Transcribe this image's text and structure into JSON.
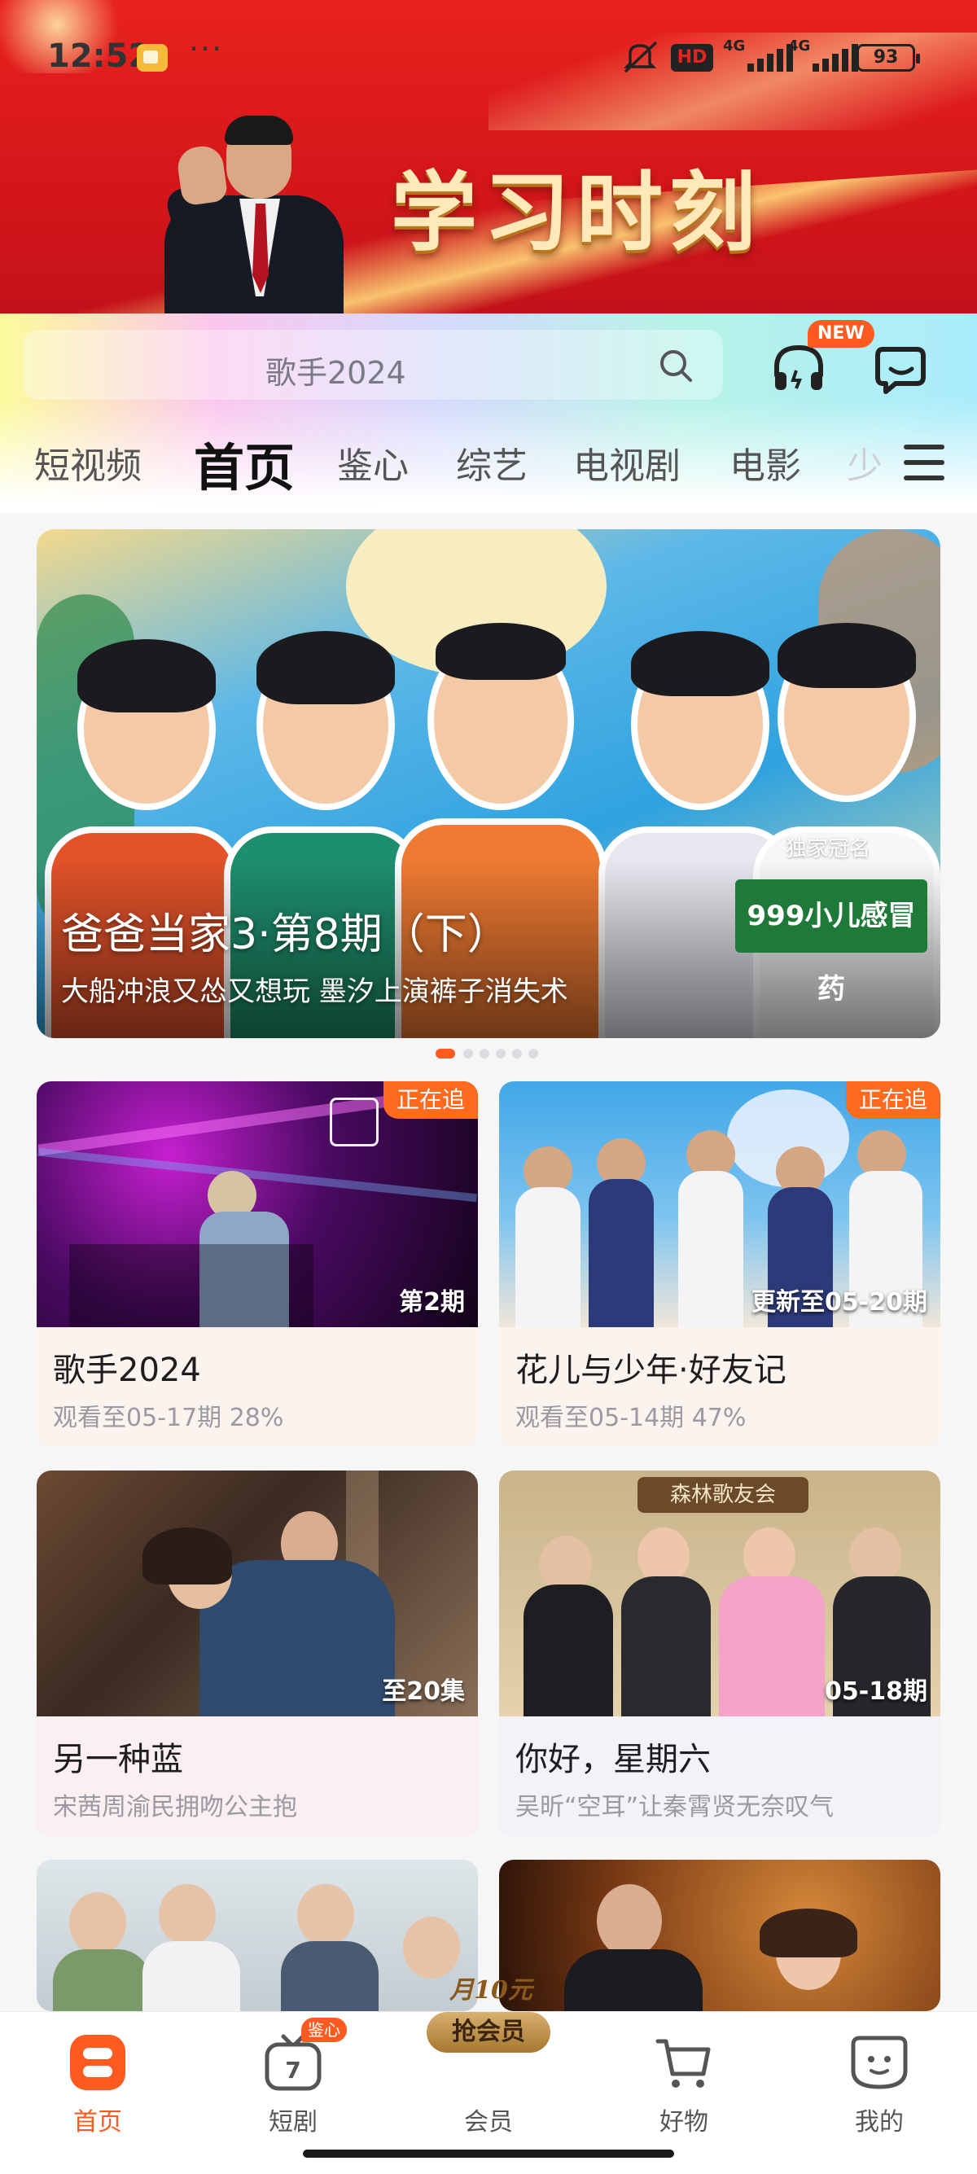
{
  "status_bar": {
    "time": "12:52",
    "more": "···",
    "hd": "HD",
    "sim1": "4G",
    "sim2": "4G",
    "battery": "93"
  },
  "banner": {
    "title": "学习时刻"
  },
  "header": {
    "search_placeholder": "歌手2024",
    "new_badge": "NEW"
  },
  "tabs": [
    {
      "label": "短视频"
    },
    {
      "label": "首页"
    },
    {
      "label": "鉴心"
    },
    {
      "label": "综艺"
    },
    {
      "label": "电视剧"
    },
    {
      "label": "电影"
    },
    {
      "label": "少"
    }
  ],
  "hero": {
    "title": "爸爸当家3·第8期（下）",
    "subtitle": "大船冲浪又怂又想玩 墨汐上演裤子消失术",
    "sponsor_tag": "独家冠名",
    "sponsor": "999小儿感冒药",
    "active_slide": 1,
    "slide_count": 6
  },
  "cards": [
    {
      "badge": "正在追",
      "overlay": "第2期",
      "name": "歌手2024",
      "info": "观看至05-17期 28%"
    },
    {
      "badge": "正在追",
      "overlay": "更新至05-20期",
      "name": "花儿与少年·好友记",
      "info": "观看至05-14期 47%"
    },
    {
      "badge": "",
      "overlay": "至20集",
      "name": "另一种蓝",
      "info": "宋茜周渝民拥吻公主抱"
    },
    {
      "badge": "",
      "overlay": "05-18期",
      "name": "你好，星期六",
      "info": "吴昕“空耳”让秦霄贤无奈叹气",
      "sign": "森林歌友会"
    },
    {
      "badge": "",
      "overlay": "",
      "name": "",
      "info": ""
    },
    {
      "badge": "",
      "overlay": "",
      "name": "",
      "info": ""
    }
  ],
  "bottom_nav": {
    "items": [
      {
        "label": "首页",
        "icon": "home-icon",
        "active": true
      },
      {
        "label": "短剧",
        "icon": "tv-icon",
        "badge": "鉴心"
      },
      {
        "label": "会员",
        "icon": "vip-icon"
      },
      {
        "label": "好物",
        "icon": "cart-icon"
      },
      {
        "label": "我的",
        "icon": "profile-icon"
      }
    ],
    "vip_promo_top": "月10元",
    "vip_promo_btn": "抢会员"
  },
  "colors": {
    "accent": "#ff5a1f",
    "banner_red": "#d6171a"
  }
}
